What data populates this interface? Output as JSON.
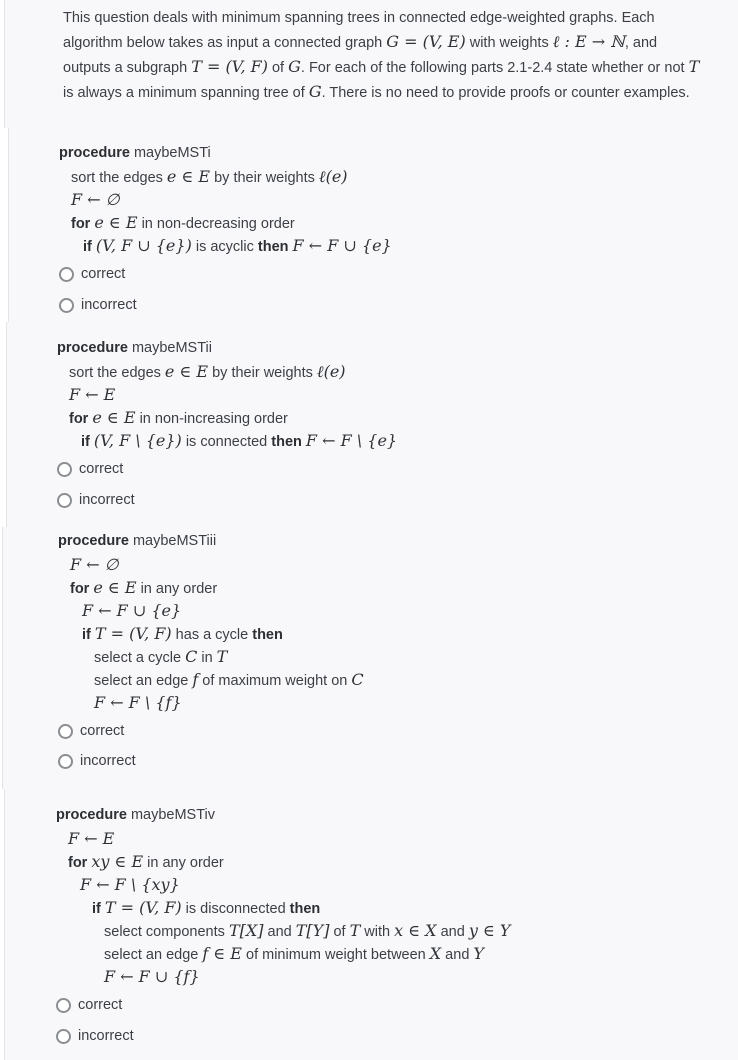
{
  "intro": {
    "parts": [
      {
        "t": "text",
        "v": "This question deals with minimum spanning trees in connected edge-weighted graphs. Each algorithm below takes as input a connected graph "
      },
      {
        "t": "math",
        "v": "G = (V, E)"
      },
      {
        "t": "text",
        "v": " with weights "
      },
      {
        "t": "math",
        "v": "ℓ : E → ℕ"
      },
      {
        "t": "text",
        "v": ", and outputs a subgraph "
      },
      {
        "t": "math",
        "v": "T = (V, F)"
      },
      {
        "t": "text",
        "v": " of "
      },
      {
        "t": "math",
        "v": "G"
      },
      {
        "t": "text",
        "v": ". For each of the following parts 2.1-2.4 state whether or not "
      },
      {
        "t": "math",
        "v": "T"
      },
      {
        "t": "text",
        "v": " is always a minimum spanning tree of "
      },
      {
        "t": "math",
        "v": "G"
      },
      {
        "t": "text",
        "v": ". There is no need to provide proofs or counter examples."
      }
    ]
  },
  "questions": [
    {
      "id": "i",
      "keyword": "procedure",
      "name": "maybeMSTi",
      "lines": [
        {
          "indent": 1,
          "parts": [
            {
              "t": "text",
              "v": "sort the edges "
            },
            {
              "t": "math",
              "v": "e ∈ E"
            },
            {
              "t": "text",
              "v": " by their weights "
            },
            {
              "t": "math",
              "v": "ℓ(e)"
            }
          ]
        },
        {
          "indent": 1,
          "parts": [
            {
              "t": "math",
              "v": "F ← ∅"
            }
          ]
        },
        {
          "indent": 1,
          "parts": [
            {
              "t": "kw",
              "v": "for"
            },
            {
              "t": "text",
              "v": " "
            },
            {
              "t": "math",
              "v": "e ∈ E"
            },
            {
              "t": "text",
              "v": " in non-decreasing order"
            }
          ]
        },
        {
          "indent": 2,
          "parts": [
            {
              "t": "kw",
              "v": "if"
            },
            {
              "t": "text",
              "v": " "
            },
            {
              "t": "math",
              "v": "(V, F ∪ {e})"
            },
            {
              "t": "text",
              "v": " is acyclic "
            },
            {
              "t": "kw",
              "v": "then"
            },
            {
              "t": "text",
              "v": " "
            },
            {
              "t": "math",
              "v": "F ← F ∪ {e}"
            }
          ]
        }
      ],
      "options": [
        "correct",
        "incorrect"
      ],
      "selected": null
    },
    {
      "id": "ii",
      "keyword": "procedure",
      "name": "maybeMSTii",
      "lines": [
        {
          "indent": 1,
          "parts": [
            {
              "t": "text",
              "v": "sort the edges "
            },
            {
              "t": "math",
              "v": "e ∈ E"
            },
            {
              "t": "text",
              "v": " by their weights "
            },
            {
              "t": "math",
              "v": "ℓ(e)"
            }
          ]
        },
        {
          "indent": 1,
          "parts": [
            {
              "t": "math",
              "v": "F ← E"
            }
          ]
        },
        {
          "indent": 1,
          "parts": [
            {
              "t": "kw",
              "v": "for"
            },
            {
              "t": "text",
              "v": " "
            },
            {
              "t": "math",
              "v": "e ∈ E"
            },
            {
              "t": "text",
              "v": " in non-increasing order"
            }
          ]
        },
        {
          "indent": 2,
          "parts": [
            {
              "t": "kw",
              "v": "if"
            },
            {
              "t": "text",
              "v": " "
            },
            {
              "t": "math",
              "v": "(V, F \\ {e})"
            },
            {
              "t": "text",
              "v": " is connected "
            },
            {
              "t": "kw",
              "v": "then"
            },
            {
              "t": "text",
              "v": " "
            },
            {
              "t": "math",
              "v": "F ← F \\ {e}"
            }
          ]
        }
      ],
      "options": [
        "correct",
        "incorrect"
      ],
      "selected": null
    },
    {
      "id": "iii",
      "keyword": "procedure",
      "name": "maybeMSTiii",
      "lines": [
        {
          "indent": 1,
          "parts": [
            {
              "t": "math",
              "v": "F ← ∅"
            }
          ]
        },
        {
          "indent": 1,
          "parts": [
            {
              "t": "kw",
              "v": "for"
            },
            {
              "t": "text",
              "v": " "
            },
            {
              "t": "math",
              "v": "e ∈ E"
            },
            {
              "t": "text",
              "v": " in any order"
            }
          ]
        },
        {
          "indent": 2,
          "parts": [
            {
              "t": "math",
              "v": "F ← F ∪ {e}"
            }
          ]
        },
        {
          "indent": 2,
          "parts": [
            {
              "t": "kw",
              "v": "if"
            },
            {
              "t": "text",
              "v": " "
            },
            {
              "t": "math",
              "v": "T = (V, F)"
            },
            {
              "t": "text",
              "v": " has a cycle "
            },
            {
              "t": "kw",
              "v": "then"
            }
          ]
        },
        {
          "indent": 3,
          "parts": [
            {
              "t": "text",
              "v": "select a cycle "
            },
            {
              "t": "math",
              "v": "C"
            },
            {
              "t": "text",
              "v": " in "
            },
            {
              "t": "math",
              "v": "T"
            }
          ]
        },
        {
          "indent": 3,
          "parts": [
            {
              "t": "text",
              "v": "select an edge "
            },
            {
              "t": "math",
              "v": "f"
            },
            {
              "t": "text",
              "v": " of maximum weight on "
            },
            {
              "t": "math",
              "v": "C"
            }
          ]
        },
        {
          "indent": 3,
          "parts": [
            {
              "t": "math",
              "v": "F ← F \\ {f}"
            }
          ]
        }
      ],
      "options": [
        "correct",
        "incorrect"
      ],
      "selected": null
    },
    {
      "id": "iv",
      "keyword": "procedure",
      "name": "maybeMSTiv",
      "lines": [
        {
          "indent": 1,
          "parts": [
            {
              "t": "math",
              "v": "F ← E"
            }
          ]
        },
        {
          "indent": 1,
          "parts": [
            {
              "t": "kw",
              "v": "for"
            },
            {
              "t": "text",
              "v": " "
            },
            {
              "t": "math",
              "v": "xy ∈ E"
            },
            {
              "t": "text",
              "v": " in any order"
            }
          ]
        },
        {
          "indent": 2,
          "parts": [
            {
              "t": "math",
              "v": "F ← F \\ {xy}"
            }
          ]
        },
        {
          "indent": 3,
          "parts": [
            {
              "t": "kw",
              "v": "if"
            },
            {
              "t": "text",
              "v": " "
            },
            {
              "t": "math",
              "v": "T = (V, F)"
            },
            {
              "t": "text",
              "v": " is disconnected "
            },
            {
              "t": "kw",
              "v": "then"
            }
          ]
        },
        {
          "indent": 4,
          "parts": [
            {
              "t": "text",
              "v": "select components "
            },
            {
              "t": "math",
              "v": "T[X]"
            },
            {
              "t": "text",
              "v": " and "
            },
            {
              "t": "math",
              "v": "T[Y]"
            },
            {
              "t": "text",
              "v": " of "
            },
            {
              "t": "math",
              "v": "T"
            },
            {
              "t": "text",
              "v": " with "
            },
            {
              "t": "math",
              "v": "x ∈ X"
            },
            {
              "t": "text",
              "v": " and "
            },
            {
              "t": "math",
              "v": "y ∈ Y"
            }
          ]
        },
        {
          "indent": 4,
          "parts": [
            {
              "t": "text",
              "v": "select an edge "
            },
            {
              "t": "math",
              "v": "f ∈ E"
            },
            {
              "t": "text",
              "v": " of minimum weight between "
            },
            {
              "t": "math",
              "v": "X"
            },
            {
              "t": "text",
              "v": " and "
            },
            {
              "t": "math",
              "v": "Y"
            }
          ]
        },
        {
          "indent": 4,
          "parts": [
            {
              "t": "math",
              "v": "F ← F ∪ {f}"
            }
          ]
        }
      ],
      "options": [
        "correct",
        "incorrect"
      ],
      "selected": null
    }
  ]
}
